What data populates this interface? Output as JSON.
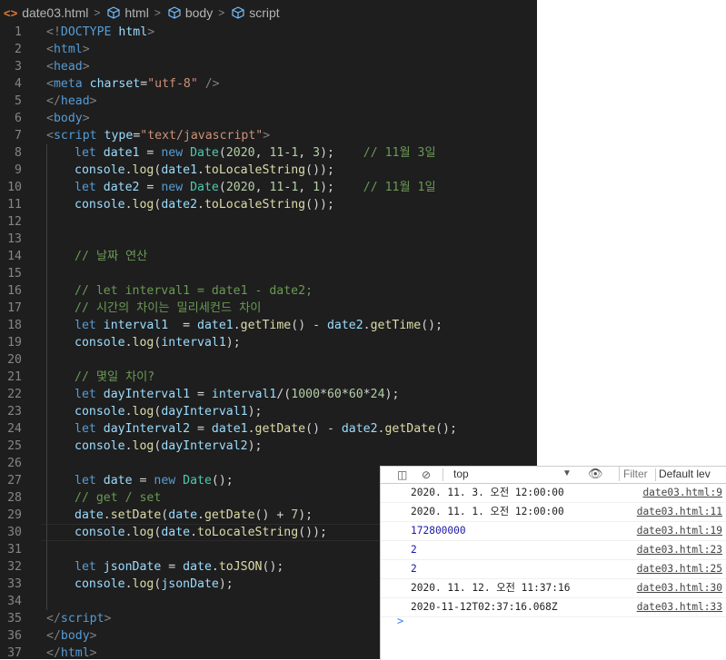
{
  "breadcrumb": {
    "file": "date03.html",
    "items": [
      "html",
      "body",
      "script"
    ]
  },
  "editor": {
    "current_line": 30,
    "lines": [
      {
        "n": "1",
        "tokens": [
          [
            "t",
            "<!"
          ],
          [
            "tag",
            "DOCTYPE"
          ],
          [
            "pl",
            " "
          ],
          [
            "attr",
            "html"
          ],
          [
            "t",
            ">"
          ]
        ]
      },
      {
        "n": "2",
        "tokens": [
          [
            "t",
            "<"
          ],
          [
            "tag",
            "html"
          ],
          [
            "t",
            ">"
          ]
        ]
      },
      {
        "n": "3",
        "tokens": [
          [
            "t",
            "<"
          ],
          [
            "tag",
            "head"
          ],
          [
            "t",
            ">"
          ]
        ]
      },
      {
        "n": "4",
        "tokens": [
          [
            "t",
            "<"
          ],
          [
            "tag",
            "meta"
          ],
          [
            "pl",
            " "
          ],
          [
            "attr",
            "charset"
          ],
          [
            "pl",
            "="
          ],
          [
            "str",
            "\"utf-8\""
          ],
          [
            "pl",
            " "
          ],
          [
            "t",
            "/>"
          ]
        ]
      },
      {
        "n": "5",
        "tokens": [
          [
            "t",
            "</"
          ],
          [
            "tag",
            "head"
          ],
          [
            "t",
            ">"
          ]
        ]
      },
      {
        "n": "6",
        "tokens": [
          [
            "t",
            "<"
          ],
          [
            "tag",
            "body"
          ],
          [
            "t",
            ">"
          ]
        ]
      },
      {
        "n": "7",
        "tokens": [
          [
            "t",
            "<"
          ],
          [
            "tag",
            "script"
          ],
          [
            "pl",
            " "
          ],
          [
            "attr",
            "type"
          ],
          [
            "pl",
            "="
          ],
          [
            "str",
            "\"text/javascript\""
          ],
          [
            "t",
            ">"
          ]
        ]
      },
      {
        "n": "8",
        "indent": true,
        "tokens": [
          [
            "kw",
            "let"
          ],
          [
            "pl",
            " "
          ],
          [
            "var",
            "date1"
          ],
          [
            "pl",
            " = "
          ],
          [
            "kw",
            "new"
          ],
          [
            "pl",
            " "
          ],
          [
            "cls",
            "Date"
          ],
          [
            "pl",
            "("
          ],
          [
            "num",
            "2020"
          ],
          [
            "pl",
            ", "
          ],
          [
            "num",
            "11"
          ],
          [
            "pl",
            "-"
          ],
          [
            "num",
            "1"
          ],
          [
            "pl",
            ", "
          ],
          [
            "num",
            "3"
          ],
          [
            "pl",
            ");    "
          ],
          [
            "cmt",
            "// 11월 3일"
          ]
        ]
      },
      {
        "n": "9",
        "indent": true,
        "tokens": [
          [
            "var",
            "console"
          ],
          [
            "pl",
            "."
          ],
          [
            "fn",
            "log"
          ],
          [
            "pl",
            "("
          ],
          [
            "var",
            "date1"
          ],
          [
            "pl",
            "."
          ],
          [
            "fn",
            "toLocaleString"
          ],
          [
            "pl",
            "());"
          ]
        ]
      },
      {
        "n": "10",
        "indent": true,
        "tokens": [
          [
            "kw",
            "let"
          ],
          [
            "pl",
            " "
          ],
          [
            "var",
            "date2"
          ],
          [
            "pl",
            " = "
          ],
          [
            "kw",
            "new"
          ],
          [
            "pl",
            " "
          ],
          [
            "cls",
            "Date"
          ],
          [
            "pl",
            "("
          ],
          [
            "num",
            "2020"
          ],
          [
            "pl",
            ", "
          ],
          [
            "num",
            "11"
          ],
          [
            "pl",
            "-"
          ],
          [
            "num",
            "1"
          ],
          [
            "pl",
            ", "
          ],
          [
            "num",
            "1"
          ],
          [
            "pl",
            ");    "
          ],
          [
            "cmt",
            "// 11월 1일"
          ]
        ]
      },
      {
        "n": "11",
        "indent": true,
        "tokens": [
          [
            "var",
            "console"
          ],
          [
            "pl",
            "."
          ],
          [
            "fn",
            "log"
          ],
          [
            "pl",
            "("
          ],
          [
            "var",
            "date2"
          ],
          [
            "pl",
            "."
          ],
          [
            "fn",
            "toLocaleString"
          ],
          [
            "pl",
            "());"
          ]
        ]
      },
      {
        "n": "12",
        "indent": true,
        "tokens": []
      },
      {
        "n": "13",
        "indent": true,
        "tokens": []
      },
      {
        "n": "14",
        "indent": true,
        "tokens": [
          [
            "cmt",
            "// 날짜 연산"
          ]
        ]
      },
      {
        "n": "15",
        "indent": true,
        "tokens": []
      },
      {
        "n": "16",
        "indent": true,
        "tokens": [
          [
            "cmt",
            "// let interval1 = date1 - date2;"
          ]
        ]
      },
      {
        "n": "17",
        "indent": true,
        "tokens": [
          [
            "cmt",
            "// 시간의 차이는 밀리세컨드 차이"
          ]
        ]
      },
      {
        "n": "18",
        "indent": true,
        "tokens": [
          [
            "kw",
            "let"
          ],
          [
            "pl",
            " "
          ],
          [
            "var",
            "interval1"
          ],
          [
            "pl",
            "  = "
          ],
          [
            "var",
            "date1"
          ],
          [
            "pl",
            "."
          ],
          [
            "fn",
            "getTime"
          ],
          [
            "pl",
            "() - "
          ],
          [
            "var",
            "date2"
          ],
          [
            "pl",
            "."
          ],
          [
            "fn",
            "getTime"
          ],
          [
            "pl",
            "();"
          ]
        ]
      },
      {
        "n": "19",
        "indent": true,
        "tokens": [
          [
            "var",
            "console"
          ],
          [
            "pl",
            "."
          ],
          [
            "fn",
            "log"
          ],
          [
            "pl",
            "("
          ],
          [
            "var",
            "interval1"
          ],
          [
            "pl",
            ");"
          ]
        ]
      },
      {
        "n": "20",
        "indent": true,
        "tokens": []
      },
      {
        "n": "21",
        "indent": true,
        "tokens": [
          [
            "cmt",
            "// 몇일 차이?"
          ]
        ]
      },
      {
        "n": "22",
        "indent": true,
        "tokens": [
          [
            "kw",
            "let"
          ],
          [
            "pl",
            " "
          ],
          [
            "var",
            "dayInterval1"
          ],
          [
            "pl",
            " = "
          ],
          [
            "var",
            "interval1"
          ],
          [
            "pl",
            "/("
          ],
          [
            "num",
            "1000"
          ],
          [
            "pl",
            "*"
          ],
          [
            "num",
            "60"
          ],
          [
            "pl",
            "*"
          ],
          [
            "num",
            "60"
          ],
          [
            "pl",
            "*"
          ],
          [
            "num",
            "24"
          ],
          [
            "pl",
            ");"
          ]
        ]
      },
      {
        "n": "23",
        "indent": true,
        "tokens": [
          [
            "var",
            "console"
          ],
          [
            "pl",
            "."
          ],
          [
            "fn",
            "log"
          ],
          [
            "pl",
            "("
          ],
          [
            "var",
            "dayInterval1"
          ],
          [
            "pl",
            ");"
          ]
        ]
      },
      {
        "n": "24",
        "indent": true,
        "tokens": [
          [
            "kw",
            "let"
          ],
          [
            "pl",
            " "
          ],
          [
            "var",
            "dayInterval2"
          ],
          [
            "pl",
            " = "
          ],
          [
            "var",
            "date1"
          ],
          [
            "pl",
            "."
          ],
          [
            "fn",
            "getDate"
          ],
          [
            "pl",
            "() - "
          ],
          [
            "var",
            "date2"
          ],
          [
            "pl",
            "."
          ],
          [
            "fn",
            "getDate"
          ],
          [
            "pl",
            "();"
          ]
        ]
      },
      {
        "n": "25",
        "indent": true,
        "tokens": [
          [
            "var",
            "console"
          ],
          [
            "pl",
            "."
          ],
          [
            "fn",
            "log"
          ],
          [
            "pl",
            "("
          ],
          [
            "var",
            "dayInterval2"
          ],
          [
            "pl",
            ");"
          ]
        ]
      },
      {
        "n": "26",
        "indent": true,
        "tokens": []
      },
      {
        "n": "27",
        "indent": true,
        "tokens": [
          [
            "kw",
            "let"
          ],
          [
            "pl",
            " "
          ],
          [
            "var",
            "date"
          ],
          [
            "pl",
            " = "
          ],
          [
            "kw",
            "new"
          ],
          [
            "pl",
            " "
          ],
          [
            "cls",
            "Date"
          ],
          [
            "pl",
            "();"
          ]
        ]
      },
      {
        "n": "28",
        "indent": true,
        "tokens": [
          [
            "cmt",
            "// get / set"
          ]
        ]
      },
      {
        "n": "29",
        "indent": true,
        "tokens": [
          [
            "var",
            "date"
          ],
          [
            "pl",
            "."
          ],
          [
            "fn",
            "setDate"
          ],
          [
            "pl",
            "("
          ],
          [
            "var",
            "date"
          ],
          [
            "pl",
            "."
          ],
          [
            "fn",
            "getDate"
          ],
          [
            "pl",
            "() + "
          ],
          [
            "num",
            "7"
          ],
          [
            "pl",
            ");"
          ]
        ]
      },
      {
        "n": "30",
        "indent": true,
        "tokens": [
          [
            "var",
            "console"
          ],
          [
            "pl",
            "."
          ],
          [
            "fn",
            "log"
          ],
          [
            "pl",
            "("
          ],
          [
            "var",
            "date"
          ],
          [
            "pl",
            "."
          ],
          [
            "fn",
            "toLocaleString"
          ],
          [
            "pl",
            "());"
          ]
        ]
      },
      {
        "n": "31",
        "indent": true,
        "tokens": []
      },
      {
        "n": "32",
        "indent": true,
        "tokens": [
          [
            "kw",
            "let"
          ],
          [
            "pl",
            " "
          ],
          [
            "var",
            "jsonDate"
          ],
          [
            "pl",
            " = "
          ],
          [
            "var",
            "date"
          ],
          [
            "pl",
            "."
          ],
          [
            "fn",
            "toJSON"
          ],
          [
            "pl",
            "();"
          ]
        ]
      },
      {
        "n": "33",
        "indent": true,
        "tokens": [
          [
            "var",
            "console"
          ],
          [
            "pl",
            "."
          ],
          [
            "fn",
            "log"
          ],
          [
            "pl",
            "("
          ],
          [
            "var",
            "jsonDate"
          ],
          [
            "pl",
            ");"
          ]
        ]
      },
      {
        "n": "34",
        "indent": true,
        "tokens": []
      },
      {
        "n": "35",
        "tokens": [
          [
            "t",
            "</"
          ],
          [
            "tag",
            "script"
          ],
          [
            "t",
            ">"
          ]
        ]
      },
      {
        "n": "36",
        "tokens": [
          [
            "t",
            "</"
          ],
          [
            "tag",
            "body"
          ],
          [
            "t",
            ">"
          ]
        ]
      },
      {
        "n": "37",
        "tokens": [
          [
            "t",
            "</"
          ],
          [
            "tag",
            "html"
          ],
          [
            "t",
            ">"
          ]
        ]
      }
    ]
  },
  "console": {
    "context": "top",
    "filter_placeholder": "Filter",
    "levels_label": "Default lev",
    "messages": [
      {
        "text": "2020. 11. 3. 오전 12:00:00",
        "source": "date03.html:9",
        "numeric": false
      },
      {
        "text": "2020. 11. 1. 오전 12:00:00",
        "source": "date03.html:11",
        "numeric": false
      },
      {
        "text": "172800000",
        "source": "date03.html:19",
        "numeric": true
      },
      {
        "text": "2",
        "source": "date03.html:23",
        "numeric": true
      },
      {
        "text": "2",
        "source": "date03.html:25",
        "numeric": true
      },
      {
        "text": "2020. 11. 12. 오전 11:37:16",
        "source": "date03.html:30",
        "numeric": false
      },
      {
        "text": "2020-11-12T02:37:16.068Z",
        "source": "date03.html:33",
        "numeric": false
      }
    ],
    "prompt": ">"
  }
}
